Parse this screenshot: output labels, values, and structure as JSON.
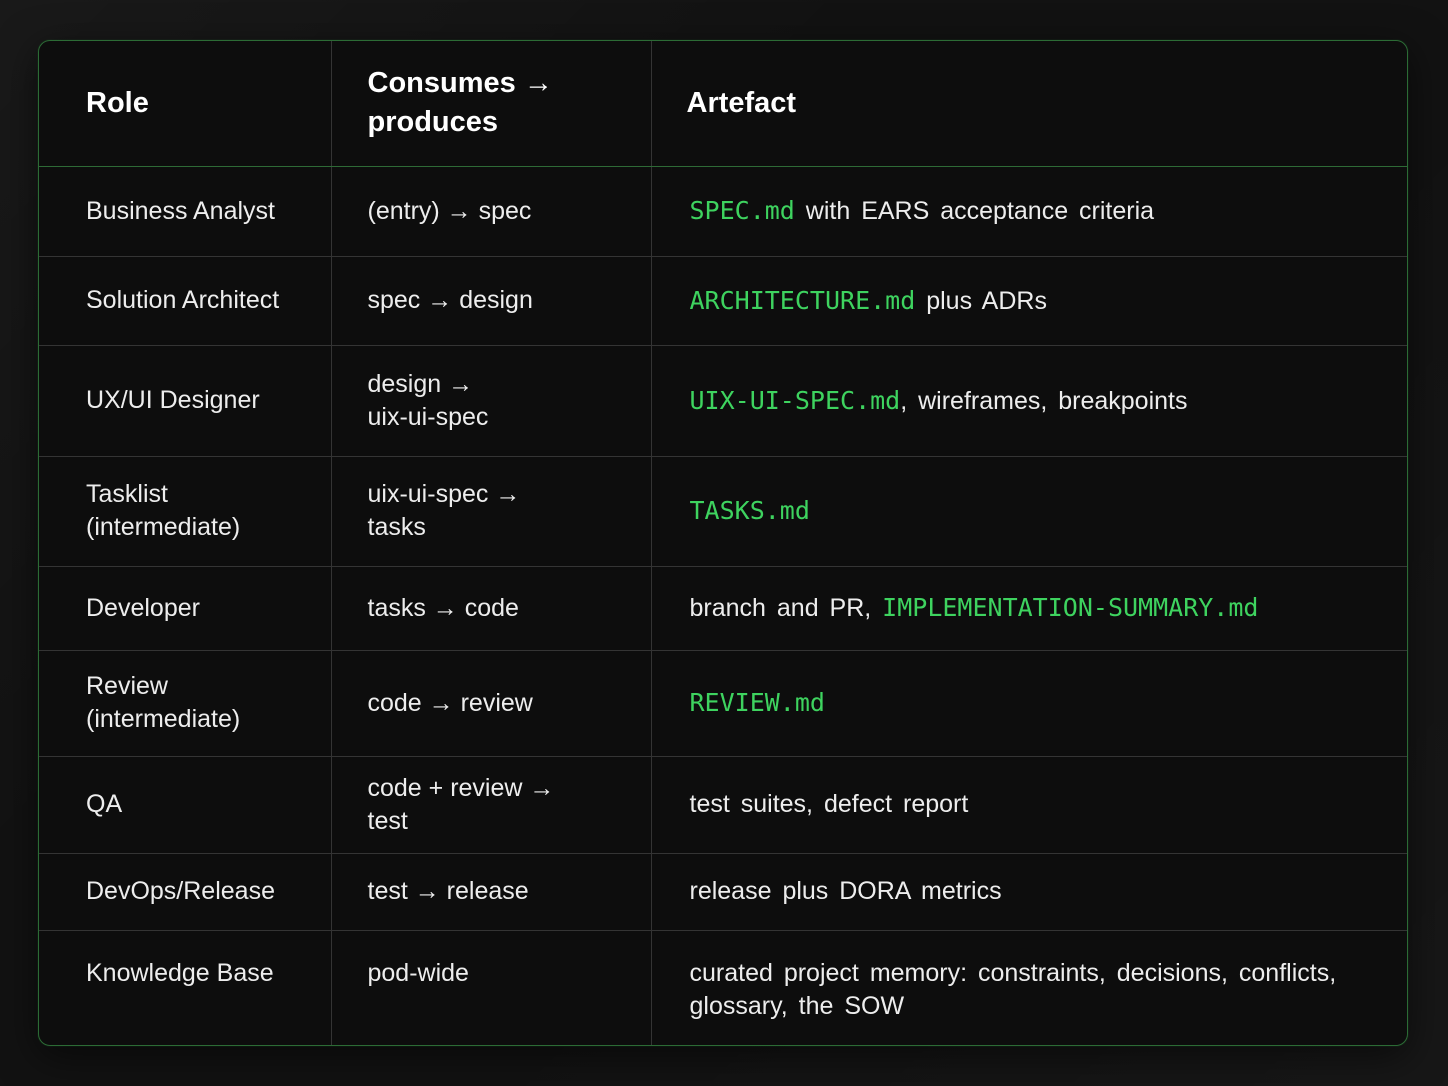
{
  "table": {
    "headers": {
      "role": "Role",
      "flow_line1": "Consumes →",
      "flow_line2": "produces",
      "artefact": "Artefact"
    },
    "rows": [
      {
        "role_line1": "Business Analyst",
        "role_line2": "",
        "flow_line1": "(entry) → spec",
        "flow_line2": "",
        "art_prefix": "",
        "art_code": "SPEC.md",
        "art_suffix": " with EARS acceptance criteria"
      },
      {
        "role_line1": "Solution Architect",
        "role_line2": "",
        "flow_line1": "spec → design",
        "flow_line2": "",
        "art_prefix": "",
        "art_code": "ARCHITECTURE.md",
        "art_suffix": " plus ADRs"
      },
      {
        "role_line1": "UX/UI Designer",
        "role_line2": "",
        "flow_line1": "design →",
        "flow_line2": "uix-ui-spec",
        "art_prefix": "",
        "art_code": "UIX-UI-SPEC.md",
        "art_suffix": ", wireframes, breakpoints"
      },
      {
        "role_line1": "Tasklist",
        "role_line2": "(intermediate)",
        "flow_line1": "uix-ui-spec →",
        "flow_line2": "tasks",
        "art_prefix": "",
        "art_code": "TASKS.md",
        "art_suffix": ""
      },
      {
        "role_line1": "Developer",
        "role_line2": "",
        "flow_line1": "tasks → code",
        "flow_line2": "",
        "art_prefix": "branch and PR, ",
        "art_code": "IMPLEMENTATION-SUMMARY.md",
        "art_suffix": ""
      },
      {
        "role_line1": "Review",
        "role_line2": "(intermediate)",
        "flow_line1": "code → review",
        "flow_line2": "",
        "art_prefix": "",
        "art_code": "REVIEW.md",
        "art_suffix": ""
      },
      {
        "role_line1": "QA",
        "role_line2": "",
        "flow_line1": "code + review →",
        "flow_line2": "test",
        "art_prefix": "test suites, defect report",
        "art_code": "",
        "art_suffix": ""
      },
      {
        "role_line1": "DevOps/Release",
        "role_line2": "",
        "flow_line1": "test → release",
        "flow_line2": "",
        "art_prefix": "release plus DORA metrics",
        "art_code": "",
        "art_suffix": ""
      },
      {
        "role_line1": "Knowledge Base",
        "role_line2": "",
        "flow_line1": "pod-wide",
        "flow_line2": "",
        "art_prefix": "curated project memory: constraints, decisions, conflicts, glossary, the SOW",
        "art_code": "",
        "art_suffix": ""
      }
    ]
  },
  "colors": {
    "accent_green": "#3ed35f",
    "border_green": "#2c6b35",
    "background": "#121212"
  }
}
